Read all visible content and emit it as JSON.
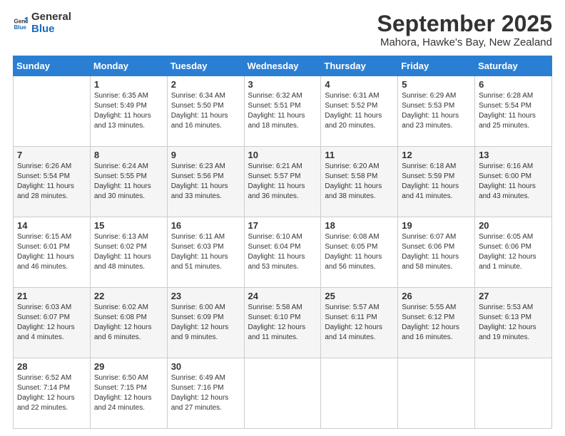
{
  "header": {
    "logo_general": "General",
    "logo_blue": "Blue",
    "month_title": "September 2025",
    "location": "Mahora, Hawke's Bay, New Zealand"
  },
  "weekdays": [
    "Sunday",
    "Monday",
    "Tuesday",
    "Wednesday",
    "Thursday",
    "Friday",
    "Saturday"
  ],
  "weeks": [
    [
      {
        "day": "",
        "info": ""
      },
      {
        "day": "1",
        "info": "Sunrise: 6:35 AM\nSunset: 5:49 PM\nDaylight: 11 hours\nand 13 minutes."
      },
      {
        "day": "2",
        "info": "Sunrise: 6:34 AM\nSunset: 5:50 PM\nDaylight: 11 hours\nand 16 minutes."
      },
      {
        "day": "3",
        "info": "Sunrise: 6:32 AM\nSunset: 5:51 PM\nDaylight: 11 hours\nand 18 minutes."
      },
      {
        "day": "4",
        "info": "Sunrise: 6:31 AM\nSunset: 5:52 PM\nDaylight: 11 hours\nand 20 minutes."
      },
      {
        "day": "5",
        "info": "Sunrise: 6:29 AM\nSunset: 5:53 PM\nDaylight: 11 hours\nand 23 minutes."
      },
      {
        "day": "6",
        "info": "Sunrise: 6:28 AM\nSunset: 5:54 PM\nDaylight: 11 hours\nand 25 minutes."
      }
    ],
    [
      {
        "day": "7",
        "info": "Sunrise: 6:26 AM\nSunset: 5:54 PM\nDaylight: 11 hours\nand 28 minutes."
      },
      {
        "day": "8",
        "info": "Sunrise: 6:24 AM\nSunset: 5:55 PM\nDaylight: 11 hours\nand 30 minutes."
      },
      {
        "day": "9",
        "info": "Sunrise: 6:23 AM\nSunset: 5:56 PM\nDaylight: 11 hours\nand 33 minutes."
      },
      {
        "day": "10",
        "info": "Sunrise: 6:21 AM\nSunset: 5:57 PM\nDaylight: 11 hours\nand 36 minutes."
      },
      {
        "day": "11",
        "info": "Sunrise: 6:20 AM\nSunset: 5:58 PM\nDaylight: 11 hours\nand 38 minutes."
      },
      {
        "day": "12",
        "info": "Sunrise: 6:18 AM\nSunset: 5:59 PM\nDaylight: 11 hours\nand 41 minutes."
      },
      {
        "day": "13",
        "info": "Sunrise: 6:16 AM\nSunset: 6:00 PM\nDaylight: 11 hours\nand 43 minutes."
      }
    ],
    [
      {
        "day": "14",
        "info": "Sunrise: 6:15 AM\nSunset: 6:01 PM\nDaylight: 11 hours\nand 46 minutes."
      },
      {
        "day": "15",
        "info": "Sunrise: 6:13 AM\nSunset: 6:02 PM\nDaylight: 11 hours\nand 48 minutes."
      },
      {
        "day": "16",
        "info": "Sunrise: 6:11 AM\nSunset: 6:03 PM\nDaylight: 11 hours\nand 51 minutes."
      },
      {
        "day": "17",
        "info": "Sunrise: 6:10 AM\nSunset: 6:04 PM\nDaylight: 11 hours\nand 53 minutes."
      },
      {
        "day": "18",
        "info": "Sunrise: 6:08 AM\nSunset: 6:05 PM\nDaylight: 11 hours\nand 56 minutes."
      },
      {
        "day": "19",
        "info": "Sunrise: 6:07 AM\nSunset: 6:06 PM\nDaylight: 11 hours\nand 58 minutes."
      },
      {
        "day": "20",
        "info": "Sunrise: 6:05 AM\nSunset: 6:06 PM\nDaylight: 12 hours\nand 1 minute."
      }
    ],
    [
      {
        "day": "21",
        "info": "Sunrise: 6:03 AM\nSunset: 6:07 PM\nDaylight: 12 hours\nand 4 minutes."
      },
      {
        "day": "22",
        "info": "Sunrise: 6:02 AM\nSunset: 6:08 PM\nDaylight: 12 hours\nand 6 minutes."
      },
      {
        "day": "23",
        "info": "Sunrise: 6:00 AM\nSunset: 6:09 PM\nDaylight: 12 hours\nand 9 minutes."
      },
      {
        "day": "24",
        "info": "Sunrise: 5:58 AM\nSunset: 6:10 PM\nDaylight: 12 hours\nand 11 minutes."
      },
      {
        "day": "25",
        "info": "Sunrise: 5:57 AM\nSunset: 6:11 PM\nDaylight: 12 hours\nand 14 minutes."
      },
      {
        "day": "26",
        "info": "Sunrise: 5:55 AM\nSunset: 6:12 PM\nDaylight: 12 hours\nand 16 minutes."
      },
      {
        "day": "27",
        "info": "Sunrise: 5:53 AM\nSunset: 6:13 PM\nDaylight: 12 hours\nand 19 minutes."
      }
    ],
    [
      {
        "day": "28",
        "info": "Sunrise: 6:52 AM\nSunset: 7:14 PM\nDaylight: 12 hours\nand 22 minutes."
      },
      {
        "day": "29",
        "info": "Sunrise: 6:50 AM\nSunset: 7:15 PM\nDaylight: 12 hours\nand 24 minutes."
      },
      {
        "day": "30",
        "info": "Sunrise: 6:49 AM\nSunset: 7:16 PM\nDaylight: 12 hours\nand 27 minutes."
      },
      {
        "day": "",
        "info": ""
      },
      {
        "day": "",
        "info": ""
      },
      {
        "day": "",
        "info": ""
      },
      {
        "day": "",
        "info": ""
      }
    ]
  ]
}
